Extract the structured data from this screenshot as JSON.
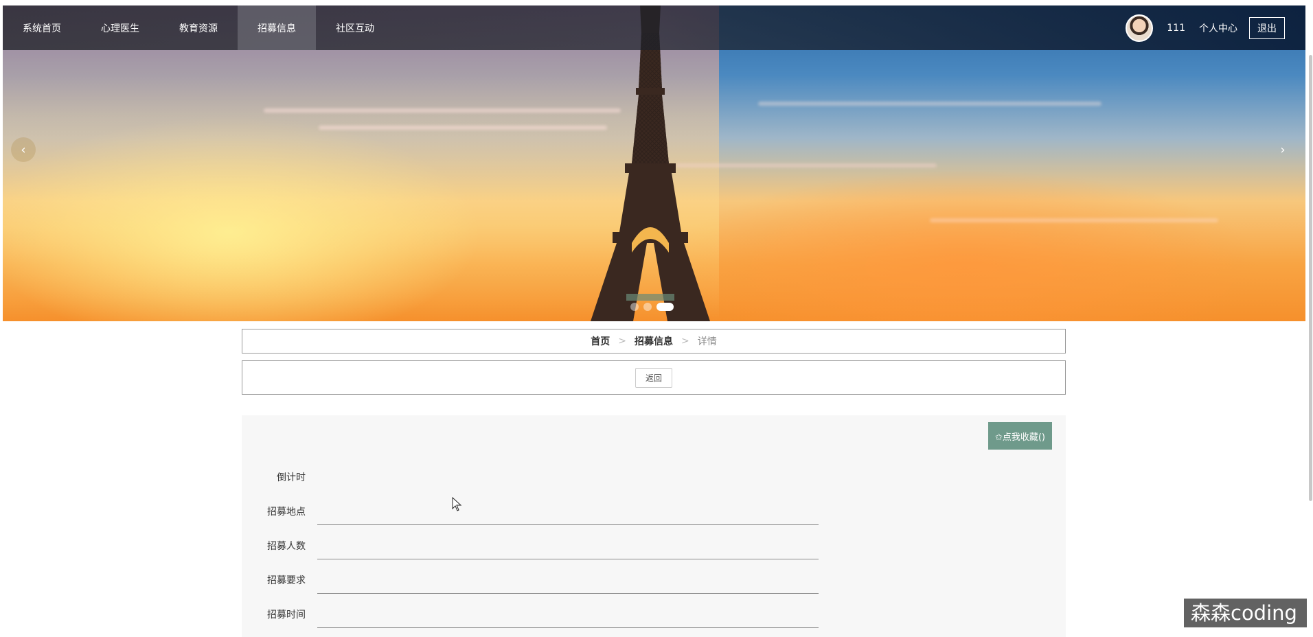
{
  "nav": {
    "items": [
      {
        "label": "系统首页",
        "active": false
      },
      {
        "label": "心理医生",
        "active": false
      },
      {
        "label": "教育资源",
        "active": false
      },
      {
        "label": "招募信息",
        "active": true
      },
      {
        "label": "社区互动",
        "active": false
      }
    ],
    "username": "111",
    "personal_center": "个人中心",
    "logout": "退出"
  },
  "carousel": {
    "prev": "‹",
    "next": "›",
    "slide_count": 3,
    "active_index": 2
  },
  "breadcrumb": {
    "home": "首页",
    "sep": ">",
    "section": "招募信息",
    "current": "详情"
  },
  "back_label": "返回",
  "favorite_label": "✩点我收藏()",
  "fields": [
    {
      "label": "倒计时",
      "value": ""
    },
    {
      "label": "招募地点",
      "value": ""
    },
    {
      "label": "招募人数",
      "value": ""
    },
    {
      "label": "招募要求",
      "value": ""
    },
    {
      "label": "招募时间",
      "value": ""
    }
  ],
  "watermark": "森森coding",
  "colors": {
    "accent_button": "#6f9a8b",
    "nav_bg": "#1e2230",
    "panel_bg": "#f7f7f7"
  }
}
